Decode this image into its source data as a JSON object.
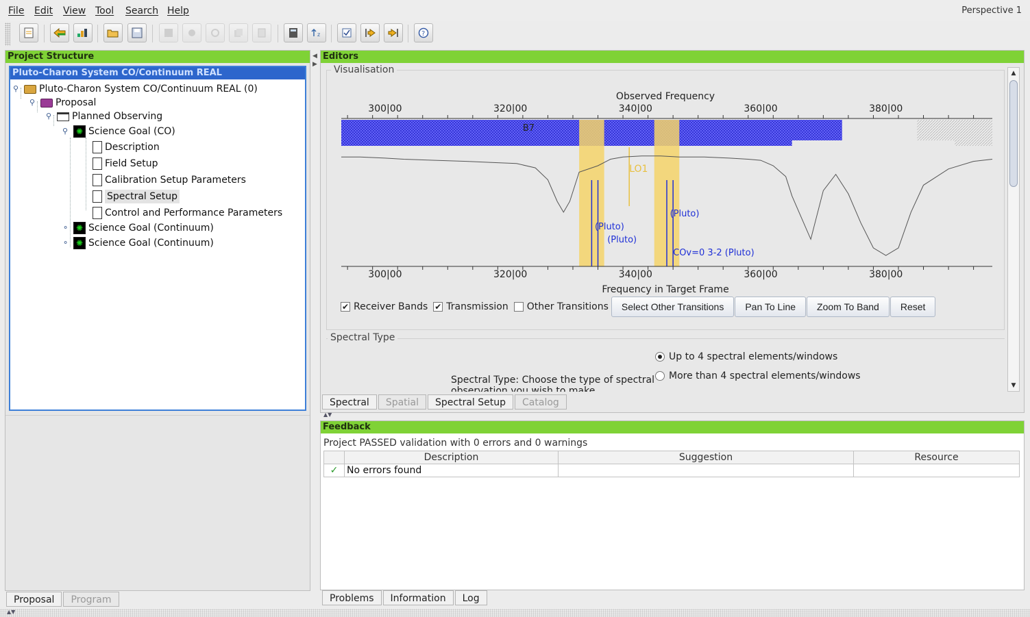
{
  "menu": [
    "File",
    "Edit",
    "View",
    "Tool",
    "Search",
    "Help"
  ],
  "perspective": "Perspective 1",
  "toolbar": {
    "buttons": [
      "new-document",
      "back",
      "chart",
      "open-folder",
      "save",
      "disabled-1",
      "disabled-2",
      "disabled-3",
      "disabled-4",
      "disabled-5",
      "calculator",
      "sort",
      "validate",
      "import",
      "export",
      "help"
    ]
  },
  "project_structure": {
    "header": "Project Structure",
    "selected": "Pluto-Charon System CO/Continuum REAL",
    "tree": {
      "root": "Pluto-Charon System CO/Continuum REAL (0)",
      "proposal": "Proposal",
      "planned": "Planned Observing",
      "goal_co": "Science Goal (CO)",
      "leaves": [
        "Description",
        "Field Setup",
        "Calibration Setup Parameters",
        "Spectral Setup",
        "Control and Performance Parameters"
      ],
      "goal_cont_1": "Science Goal (Continuum)",
      "goal_cont_2": "Science Goal (Continuum)"
    },
    "tabs": [
      "Proposal",
      "Program"
    ]
  },
  "editors": {
    "header": "Editors",
    "visualisation_title": "Visualisation",
    "chart_data": {
      "type": "line",
      "title": "Observed Frequency",
      "xlabel": "Frequency in Target Frame",
      "xlim": [
        293,
        397
      ],
      "top_ticks": [
        "300|00",
        "320|00",
        "340|00",
        "360|00",
        "380|00"
      ],
      "bottom_ticks": [
        "300|00",
        "320|00",
        "340|00",
        "360|00",
        "380|00"
      ],
      "band_label": "B7",
      "lo_label": "LO1",
      "band_range": [
        293,
        373
      ],
      "band_range_lower": [
        293,
        365
      ],
      "spectral_windows": [
        [
          331,
          335
        ],
        [
          343,
          347
        ]
      ],
      "line_labels": [
        "(Pluto)",
        "(Pluto)",
        "(Pluto)",
        "COv=0 3-2 (Pluto)"
      ],
      "transmission": {
        "x": [
          293,
          296,
          300,
          303,
          308,
          313,
          317,
          321,
          324,
          326,
          327.5,
          328.5,
          329.5,
          331,
          334,
          336,
          338,
          341,
          344,
          347,
          351,
          355,
          358,
          360,
          362,
          364,
          365,
          366.5,
          368,
          370,
          372,
          374,
          376,
          378,
          380,
          382,
          384,
          386,
          390,
          394,
          397
        ],
        "y": [
          0.96,
          0.96,
          0.95,
          0.94,
          0.93,
          0.92,
          0.91,
          0.9,
          0.86,
          0.75,
          0.55,
          0.45,
          0.55,
          0.82,
          0.88,
          0.94,
          0.96,
          0.97,
          0.97,
          0.96,
          0.96,
          0.95,
          0.94,
          0.93,
          0.88,
          0.78,
          0.6,
          0.4,
          0.2,
          0.65,
          0.8,
          0.62,
          0.35,
          0.12,
          0.05,
          0.12,
          0.45,
          0.7,
          0.85,
          0.92,
          0.94
        ]
      }
    },
    "checkboxes": [
      {
        "label": "Receiver Bands",
        "checked": true
      },
      {
        "label": "Transmission",
        "checked": true
      },
      {
        "label": "Other Transitions",
        "checked": false
      }
    ],
    "buttons": [
      "Select Other Transitions",
      "Pan To Line",
      "Zoom To Band",
      "Reset"
    ],
    "spectral_type": {
      "title": "Spectral Type",
      "prompt_line1": "Spectral Type: Choose the type of spectral",
      "prompt_line2": "observation you wish to make",
      "options": [
        "Up to 4 spectral elements/windows",
        "More than 4 spectral elements/windows"
      ],
      "selected": 0
    },
    "tabs": [
      "Spectral",
      "Spatial",
      "Spectral Setup",
      "Catalog"
    ]
  },
  "feedback": {
    "header": "Feedback",
    "status": "Project PASSED validation with 0 errors and 0 warnings",
    "columns": [
      "Description",
      "Suggestion",
      "Resource"
    ],
    "rows": [
      {
        "description": "No errors found",
        "suggestion": "",
        "resource": ""
      }
    ],
    "tabs": [
      "Problems",
      "Information",
      "Log"
    ]
  },
  "colors": {
    "accent_green": "#7fd236",
    "selection_blue": "#2d66cc",
    "band_blue": "#3a3aff",
    "window_yellow": "#f5d36a"
  }
}
